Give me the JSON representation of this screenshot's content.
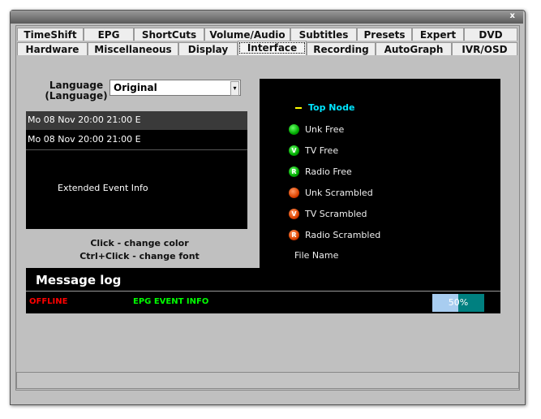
{
  "window": {
    "close_label": "x"
  },
  "tabs_row1": [
    "TimeShift",
    "EPG",
    "ShortCuts",
    "Volume/Audio",
    "Subtitles",
    "Presets",
    "Expert",
    "DVD"
  ],
  "tabs_row2": [
    "Hardware",
    "Miscellaneous",
    "Display",
    "Interface",
    "Recording",
    "AutoGraph",
    "IVR/OSD"
  ],
  "selected_tab": "Interface",
  "language": {
    "label_line1": "Language",
    "label_line2": "(Language)",
    "value": "Original"
  },
  "epg_list": {
    "rows": [
      "Mo 08 Nov 20:00  21:00  E",
      "Mo 08 Nov 20:00  21:00  E"
    ],
    "extended_info": "Extended Event Info"
  },
  "hints": {
    "line1": "Click - change color",
    "line2": "Ctrl+Click - change font"
  },
  "tree": {
    "top_node": "Top Node",
    "items": [
      {
        "label": "Unk Free",
        "badge": "",
        "color": "green"
      },
      {
        "label": "TV Free",
        "badge": "V",
        "color": "green"
      },
      {
        "label": "Radio Free",
        "badge": "R",
        "color": "green"
      },
      {
        "label": "Unk Scrambled",
        "badge": "",
        "color": "red"
      },
      {
        "label": "TV Scrambled",
        "badge": "V",
        "color": "red"
      },
      {
        "label": "Radio Scrambled",
        "badge": "R",
        "color": "red"
      }
    ],
    "file_name": "File Name"
  },
  "message_log": {
    "title": "Message log",
    "status": "OFFLINE",
    "info": "EPG EVENT INFO",
    "progress_text": "50%",
    "progress": 50
  },
  "colors": {
    "offline": "#ff0000",
    "info": "#00ff00",
    "top_node": "#00e5ff",
    "progress_left": "#a8cdf0",
    "progress_right": "#008080"
  }
}
